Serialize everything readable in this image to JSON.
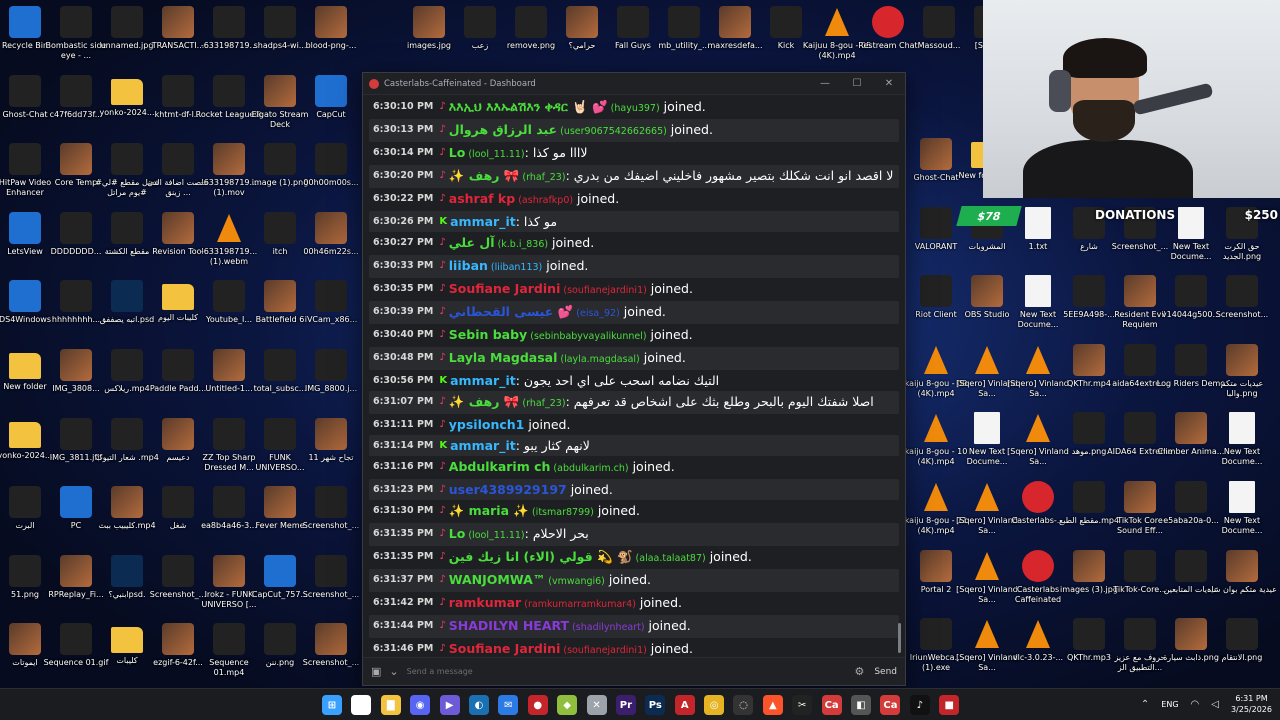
{
  "desktop": {
    "icons_left": [
      "Recycle Bin",
      "Bombastic side eye - ...",
      "unnamed.jpg",
      "TRANSACTI...",
      "-633198719...",
      "shadps4-wi...",
      "blood-png-...",
      "Ghost-Chat",
      "c47f6dd73f...",
      "yonko-2024...",
      "khtmt-df-l...",
      "Rocket League®",
      "Elgato Stream Deck",
      "CapCut",
      "HitPaw Video Enhancer",
      "Core Temp",
      "#فضل مقطع #لي يوم مراتل#",
      "خلصت اضافة الدن زينق ...",
      "-633198719... (1).mov",
      "image (1).png",
      "00h00m00s...",
      "LetsView",
      "DDDDDDD...",
      "مقطع الكشتة",
      "Revision Tool",
      "-633198719... (1).webm",
      "itch",
      "00h46m22s...",
      "DS4Windows",
      "hhhhhhhh...",
      "اتبه يصففق.psd",
      "كليبات اليوم",
      "Youtube_I...",
      "Battlefield 6",
      "iVCam_x86...",
      "New folder",
      "IMG_3808...",
      "ريلاكس.mp4",
      "Paddle Padd...",
      "Untitled-1...",
      "total_subsc...",
      "IMG_8800.j...",
      "yonko-2024...",
      "IMG_3811.jfif",
      "شعار التيوب .mp4",
      "دعيسم",
      "ZZ Top Sharp Dressed M...",
      "FUNK UNIVERSO...",
      "تجاح شهر 11",
      "البرت",
      "PC",
      "كليبيب ببث.mp4",
      "شغل",
      "ea8b4a46-3...",
      "Fever Meme",
      "Screenshot_...",
      "51.png",
      "RPReplay_Fi...",
      "ابنبي؟psd.",
      "Screenshot_...",
      "Irokz - FUNK UNIVERSO [...",
      "CapCut_757...",
      "Screenshot_...",
      "ايموتات",
      "Sequence 01.gif",
      "كليبات",
      "ezgif-6-42f...",
      "Sequence 01.mp4",
      "ننن.png",
      "Screenshot_..."
    ],
    "icons_top_middle": [
      "images.jpg",
      "زعب",
      "remove.png",
      "حرامي؟",
      "Fall Guys",
      "mb_utility_...",
      "maxresdefa...",
      "Kick",
      "Kaijuu 8-gou - 05 (4K).mp4",
      "Restream Chat",
      "Massoud...",
      "[S Vinla"
    ],
    "icons_right": [
      "Ghost-Chat",
      "New folder (2)",
      "Ghost-Chat",
      "كلبات اوبي اس",
      "Dark Hours Prologue",
      "العيديات.png",
      "Install VALORANT...",
      "VALORANT",
      "المشروبات",
      "1.txt",
      "شارع",
      "Screenshot_...",
      "New Text Docume...",
      "حق الكرت الجديد.png",
      "Riot Client",
      "OBS Studio",
      "New Text Docume...",
      "5EE9A498-...",
      "Resident Evil Requiem",
      "v14044g500...",
      "Screenshot...",
      "kaiju 8-gou - 09 (4K).mp4",
      "[Sqero] Vinland Sa...",
      "[Sqero] Vinland Sa...",
      "QKThr.mp4",
      "aida64extre...",
      "Log Riders Demo",
      "عيديات متكم والبا.png",
      "kaiju 8-gou - 10 (4K).mp4",
      "New Text Docume...",
      "[Sqero] Vinland Sa...",
      "موهد.png",
      "AIDA64 Extreme",
      "Climber Anima...",
      "New Text Docume...",
      "kaiju 8-gou - 11 (4K).mp4",
      "[Sqero] Vinland Sa...",
      "Casterlabs-...",
      "مقطع الطبع.mp4",
      "TikTok Core Sound Eff...",
      "e5aba20a-0...",
      "New Text Docume...",
      "Portal 2",
      "[Sqero] Vinland Sa...",
      "Casterlabs Caffeinated",
      "images (3).jpg",
      "TikTok-Core...",
      "عيديات المتابعين",
      "عيدية متكم بوان شاه",
      "IriunWebca... (1).exe",
      "[Sqero] Vinland Sa...",
      "vlc-3.0.23-...",
      "QKThr.mp3",
      "حروف مع عزيز التطبيق الز...",
      "ذابث سيارة.png",
      "الانتقام.png"
    ]
  },
  "donation": {
    "amount": "$78",
    "title": "DONATIONS",
    "goal": "$250"
  },
  "chat_window": {
    "title": "Casterlabs-Caffeinated - Dashboard",
    "controls": [
      "—",
      "☐",
      "✕"
    ],
    "composer_placeholder": "Send a message",
    "send_label": "Send",
    "messages": [
      {
        "time": "6:30:10 PM",
        "platform": "tiktok",
        "display": "እእኢህ እእኡልሽእን ቀዳር 🤘🏻 💕",
        "user": "(hayu397)",
        "text": " joined.",
        "name_color": "#4ade3c",
        "user_color": "#4ade3c"
      },
      {
        "time": "6:30:13 PM",
        "platform": "tiktok",
        "display": "عبد الرزاق هروال",
        "user": "(user9067542662665)",
        "text": " joined.",
        "name_color": "#4ade3c",
        "user_color": "#4ade3c"
      },
      {
        "time": "6:30:14 PM",
        "platform": "tiktok",
        "display": "Lo",
        "user": "(lool_11.11)",
        "text": ": لاااا مو كذا",
        "name_color": "#4ade3c",
        "user_color": "#4ade3c"
      },
      {
        "time": "6:30:20 PM",
        "platform": "tiktok",
        "display": "✨ رهف 🎀",
        "user": "(rhaf_23)",
        "text": ": لا اقصد انو انت شكلك بتصير مشهور فاخليني اضيفك من بدري",
        "name_color": "#4ade3c",
        "user_color": "#4ade3c"
      },
      {
        "time": "6:30:22 PM",
        "platform": "tiktok",
        "display": "ashraf kp",
        "user": "(ashrafkp0)",
        "text": " joined.",
        "name_color": "#e0263a",
        "user_color": "#e0263a"
      },
      {
        "time": "6:30:26 PM",
        "platform": "kick",
        "display": "ammar_it",
        "user": "",
        "text": ": مو كذا",
        "name_color": "#36b8ff",
        "user_color": "#36b8ff"
      },
      {
        "time": "6:30:27 PM",
        "platform": "tiktok",
        "display": "آل علي",
        "user": "(k.b.i_836)",
        "text": " joined.",
        "name_color": "#4ade3c",
        "user_color": "#4ade3c"
      },
      {
        "time": "6:30:33 PM",
        "platform": "tiktok",
        "display": "liiban",
        "user": "(liiban113)",
        "text": " joined.",
        "name_color": "#36b8ff",
        "user_color": "#36b8ff"
      },
      {
        "time": "6:30:35 PM",
        "platform": "tiktok",
        "display": "Soufiane Jardini",
        "user": "(soufianejardini1)",
        "text": " joined.",
        "name_color": "#e0263a",
        "user_color": "#e0263a"
      },
      {
        "time": "6:30:39 PM",
        "platform": "tiktok",
        "display": "عيسى القحطاني 💕",
        "user": "(eisa_92)",
        "text": " joined.",
        "name_color": "#2b55d9",
        "user_color": "#2b55d9"
      },
      {
        "time": "6:30:40 PM",
        "platform": "tiktok",
        "display": "Sebin baby",
        "user": "(sebinbabyvayalikunnel)",
        "text": " joined.",
        "name_color": "#4ade3c",
        "user_color": "#4ade3c"
      },
      {
        "time": "6:30:48 PM",
        "platform": "tiktok",
        "display": "Layla Magdasal",
        "user": "(layla.magdasal)",
        "text": " joined.",
        "name_color": "#4ade3c",
        "user_color": "#4ade3c"
      },
      {
        "time": "6:30:56 PM",
        "platform": "kick",
        "display": "ammar_it",
        "user": "",
        "text": ": التيك نضامه اسحب على اي احد يجون",
        "name_color": "#36b8ff",
        "user_color": "#36b8ff"
      },
      {
        "time": "6:31:07 PM",
        "platform": "tiktok",
        "display": "✨ رهف 🎀",
        "user": "(rhaf_23)",
        "text": ": اصلا شفتك اليوم بالبحر وطلع بثك على اشخاص قد تعرفهم",
        "name_color": "#4ade3c",
        "user_color": "#4ade3c"
      },
      {
        "time": "6:31:11 PM",
        "platform": "tiktok",
        "display": "ypsilonch1",
        "user": "",
        "text": " joined.",
        "name_color": "#36b8ff",
        "user_color": "#36b8ff"
      },
      {
        "time": "6:31:14 PM",
        "platform": "kick",
        "display": "ammar_it",
        "user": "",
        "text": ": لانهم كثار يبو",
        "name_color": "#36b8ff",
        "user_color": "#36b8ff"
      },
      {
        "time": "6:31:16 PM",
        "platform": "tiktok",
        "display": "Abdulkarim ch",
        "user": "(abdulkarim.ch)",
        "text": " joined.",
        "name_color": "#4ade3c",
        "user_color": "#4ade3c"
      },
      {
        "time": "6:31:23 PM",
        "platform": "tiktok",
        "display": "user4389929197",
        "user": "",
        "text": " joined.",
        "name_color": "#2b55d9",
        "user_color": "#2b55d9"
      },
      {
        "time": "6:31:30 PM",
        "platform": "tiktok",
        "display": "✨ maria ✨",
        "user": "(itsmar8799)",
        "text": " joined.",
        "name_color": "#4ade3c",
        "user_color": "#4ade3c"
      },
      {
        "time": "6:31:35 PM",
        "platform": "tiktok",
        "display": "Lo",
        "user": "(lool_11.11)",
        "text": ": بحر الاحلام",
        "name_color": "#4ade3c",
        "user_color": "#4ade3c"
      },
      {
        "time": "6:31:35 PM",
        "platform": "tiktok",
        "display": "قولي (الاء) انا زيك فين 💫 🐒",
        "user": "(alaa.talaat87)",
        "text": " joined.",
        "name_color": "#4ade3c",
        "user_color": "#4ade3c"
      },
      {
        "time": "6:31:37 PM",
        "platform": "tiktok",
        "display": "WANJOMWA™",
        "user": "(vmwangi6)",
        "text": " joined.",
        "name_color": "#4ade3c",
        "user_color": "#4ade3c"
      },
      {
        "time": "6:31:42 PM",
        "platform": "tiktok",
        "display": "ramkumar",
        "user": "(ramkumarramkumar4)",
        "text": " joined.",
        "name_color": "#e0263a",
        "user_color": "#e0263a"
      },
      {
        "time": "6:31:44 PM",
        "platform": "tiktok",
        "display": "SHADILYN HEART",
        "user": "(shadilynheart)",
        "text": " joined.",
        "name_color": "#8a3ad9",
        "user_color": "#8a3ad9"
      },
      {
        "time": "6:31:46 PM",
        "platform": "tiktok",
        "display": "Soufiane Jardini",
        "user": "(soufianejardini1)",
        "text": " joined.",
        "name_color": "#e0263a",
        "user_color": "#e0263a"
      }
    ]
  },
  "taskbar": {
    "icons": [
      {
        "name": "windows-start-icon",
        "glyph": "⊞",
        "color": "#3aa0ff"
      },
      {
        "name": "search-icon",
        "glyph": "⌕",
        "color": "#ffffff"
      },
      {
        "name": "file-explorer-icon",
        "glyph": "▇",
        "color": "#f3c33f"
      },
      {
        "name": "discord-icon",
        "glyph": "◉",
        "color": "#5865f2"
      },
      {
        "name": "media-player-icon",
        "glyph": "▶",
        "color": "#6b5bd6"
      },
      {
        "name": "steam-icon",
        "glyph": "◐",
        "color": "#1b6fb3"
      },
      {
        "name": "mail-icon",
        "glyph": "✉",
        "color": "#2c7be5"
      },
      {
        "name": "red-app-icon",
        "glyph": "●",
        "color": "#c4252a"
      },
      {
        "name": "epic-icon",
        "glyph": "◆",
        "color": "#8fbf3d"
      },
      {
        "name": "xbox-icon",
        "glyph": "✕",
        "color": "#9da3aa"
      },
      {
        "name": "premiere-icon",
        "glyph": "Pr",
        "color": "#3b1f6e"
      },
      {
        "name": "photoshop-icon",
        "glyph": "Ps",
        "color": "#0c2b52"
      },
      {
        "name": "acrobat-icon",
        "glyph": "A",
        "color": "#c4252a"
      },
      {
        "name": "chrome-icon",
        "glyph": "◎",
        "color": "#e6b325"
      },
      {
        "name": "obs-icon",
        "glyph": "◌",
        "color": "#333333"
      },
      {
        "name": "brave-icon",
        "glyph": "▲",
        "color": "#fb542b"
      },
      {
        "name": "capcut-icon",
        "glyph": "✂",
        "color": "#222222"
      },
      {
        "name": "casterlabs-icon",
        "glyph": "Ca",
        "color": "#d43b3b"
      },
      {
        "name": "game-icon",
        "glyph": "◧",
        "color": "#555555"
      },
      {
        "name": "casterlabs2-icon",
        "glyph": "Ca",
        "color": "#d43b3b"
      },
      {
        "name": "tiktok-icon",
        "glyph": "♪",
        "color": "#111111"
      },
      {
        "name": "red-app2-icon",
        "glyph": "■",
        "color": "#c4252a"
      }
    ],
    "tray": {
      "lang": "ENG",
      "time": "6:31 PM",
      "date": "3/25/2026"
    }
  }
}
